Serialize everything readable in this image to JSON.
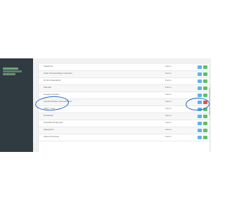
{
  "sidebar": {
    "items": [
      {
        "label": ""
      },
      {
        "label": ""
      },
      {
        "label": ""
      }
    ]
  },
  "rows": [
    {
      "name": "Facebook",
      "status": "Forum"
    },
    {
      "name": "Gitter Finance/Page Interplans",
      "status": "Forum"
    },
    {
      "name": "ID Grid Newsletter",
      "status": "Forum"
    },
    {
      "name": "Kalmbar",
      "status": "Forum"
    },
    {
      "name": "Google Analytics",
      "status": "Forum"
    },
    {
      "name": "Solution/Dealer Optimalization",
      "status": "Forum"
    },
    {
      "name": "CRM / Lead",
      "status": "Forum"
    },
    {
      "name": "Newsletter",
      "status": "Forum"
    },
    {
      "name": "Kontaktbuch Einsatz",
      "status": "Forum"
    },
    {
      "name": "Kategorien",
      "status": "Forum"
    },
    {
      "name": "Saved Checkout",
      "status": "Forum"
    }
  ],
  "colors": {
    "sidebar_bg": "#2f3b40",
    "edit_button": "#58b7e6",
    "ok_button": "#5cc06c",
    "delete_button": "#e5534b",
    "annotation": "#2a67c7"
  },
  "icons": {
    "edit": "edit-icon",
    "enable": "check-icon",
    "delete": "trash-icon"
  }
}
